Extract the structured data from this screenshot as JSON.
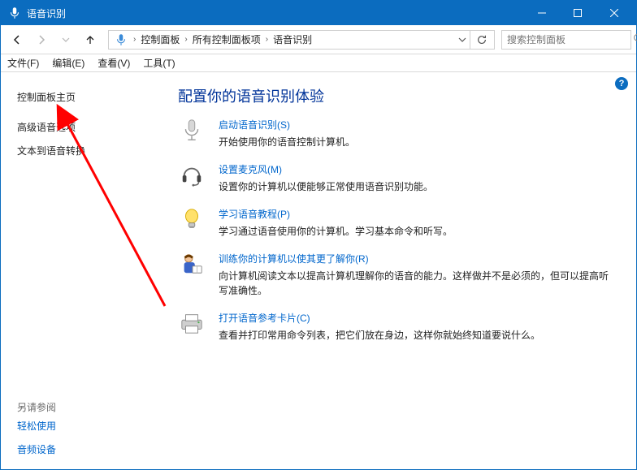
{
  "window": {
    "title": "语音识别"
  },
  "breadcrumbs": {
    "parts": [
      "控制面板",
      "所有控制面板项",
      "语音识别"
    ]
  },
  "search": {
    "placeholder": "搜索控制面板"
  },
  "menu": {
    "file": "文件(F)",
    "edit": "编辑(E)",
    "view": "查看(V)",
    "tools": "工具(T)"
  },
  "sidebar": {
    "home": "控制面板主页",
    "advanced": "高级语音选项",
    "tts": "文本到语音转换",
    "see_also": "另请参阅",
    "ease": "轻松使用",
    "audio": "音频设备"
  },
  "main": {
    "heading": "配置你的语音识别体验",
    "items": [
      {
        "link": "启动语音识别(S)",
        "desc": "开始使用你的语音控制计算机。"
      },
      {
        "link": "设置麦克风(M)",
        "desc": "设置你的计算机以便能够正常使用语音识别功能。"
      },
      {
        "link": "学习语音教程(P)",
        "desc": "学习通过语音使用你的计算机。学习基本命令和听写。"
      },
      {
        "link": "训练你的计算机以使其更了解你(R)",
        "desc": "向计算机阅读文本以提高计算机理解你的语音的能力。这样做并不是必须的，但可以提高听写准确性。"
      },
      {
        "link": "打开语音参考卡片(C)",
        "desc": "查看并打印常用命令列表，把它们放在身边，这样你就始终知道要说什么。"
      }
    ]
  },
  "help": "?"
}
